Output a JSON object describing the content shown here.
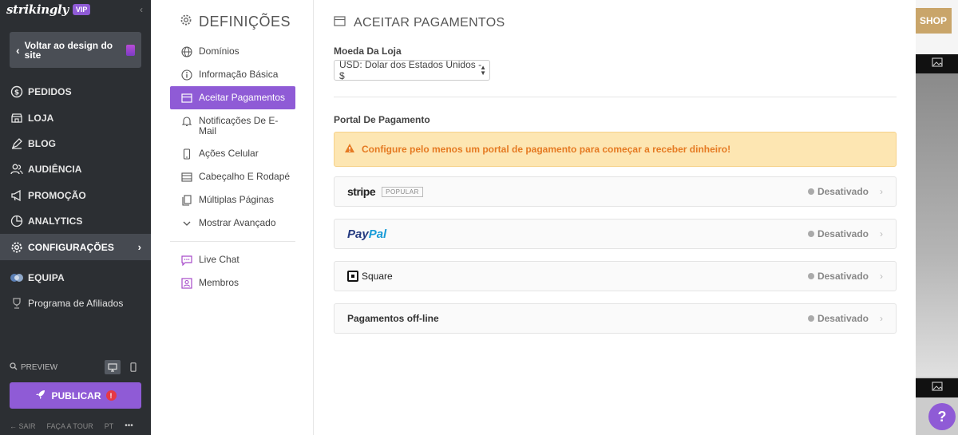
{
  "brand": {
    "logo": "strikingly",
    "badge": "VIP"
  },
  "sidebar": {
    "back_label": "Voltar ao design do site",
    "items": [
      {
        "label": "PEDIDOS",
        "icon": "dollar-icon"
      },
      {
        "label": "LOJA",
        "icon": "store-icon"
      },
      {
        "label": "BLOG",
        "icon": "pen-icon"
      },
      {
        "label": "AUDIÊNCIA",
        "icon": "users-icon"
      },
      {
        "label": "PROMOÇÃO",
        "icon": "megaphone-icon"
      },
      {
        "label": "ANALYTICS",
        "icon": "pie-chart-icon"
      },
      {
        "label": "CONFIGURAÇÕES",
        "icon": "gear-icon"
      },
      {
        "label": "EQUIPA",
        "icon": "team-icon"
      },
      {
        "label": "Programa de Afiliados",
        "icon": "trophy-icon"
      }
    ],
    "preview_label": "PREVIEW",
    "publish_label": "PUBLICAR",
    "publish_alert": "!",
    "footer": {
      "exit": "SAIR",
      "tour": "FAÇA A TOUR",
      "lang": "PT",
      "more": "•••"
    }
  },
  "settings": {
    "title": "DEFINIÇÕES",
    "items": [
      {
        "label": "Domínios",
        "icon": "globe-icon"
      },
      {
        "label": "Informação Básica",
        "icon": "info-icon"
      },
      {
        "label": "Aceitar Pagamentos",
        "icon": "payment-icon"
      },
      {
        "label": "Notificações De E-Mail",
        "icon": "bell-icon"
      },
      {
        "label": "Ações Celular",
        "icon": "phone-icon"
      },
      {
        "label": "Cabeçalho E Rodapé",
        "icon": "header-footer-icon"
      },
      {
        "label": "Múltiplas Páginas",
        "icon": "pages-icon"
      },
      {
        "label": "Mostrar Avançado",
        "icon": "chevron-down-icon"
      }
    ],
    "extra_items": [
      {
        "label": "Live Chat",
        "icon": "chat-icon"
      },
      {
        "label": "Membros",
        "icon": "member-icon"
      }
    ]
  },
  "payments": {
    "title": "ACEITAR PAGAMENTOS",
    "currency_label": "Moeda Da Loja",
    "currency_value": "USD: Dolar dos Estados Unidos - $",
    "portal_label": "Portal De Pagamento",
    "warning": "Configure pelo menos um portal de pagamento para começar a receber dinheiro!",
    "gateways": [
      {
        "name": "stripe",
        "badge": "POPULAR",
        "status": "Desativado"
      },
      {
        "name_a": "Pay",
        "name_b": "Pal",
        "status": "Desativado"
      },
      {
        "name": "Square",
        "status": "Desativado"
      },
      {
        "name": "Pagamentos off-line",
        "status": "Desativado"
      }
    ]
  },
  "preview": {
    "shop_label": "SHOP"
  },
  "help_label": "?"
}
